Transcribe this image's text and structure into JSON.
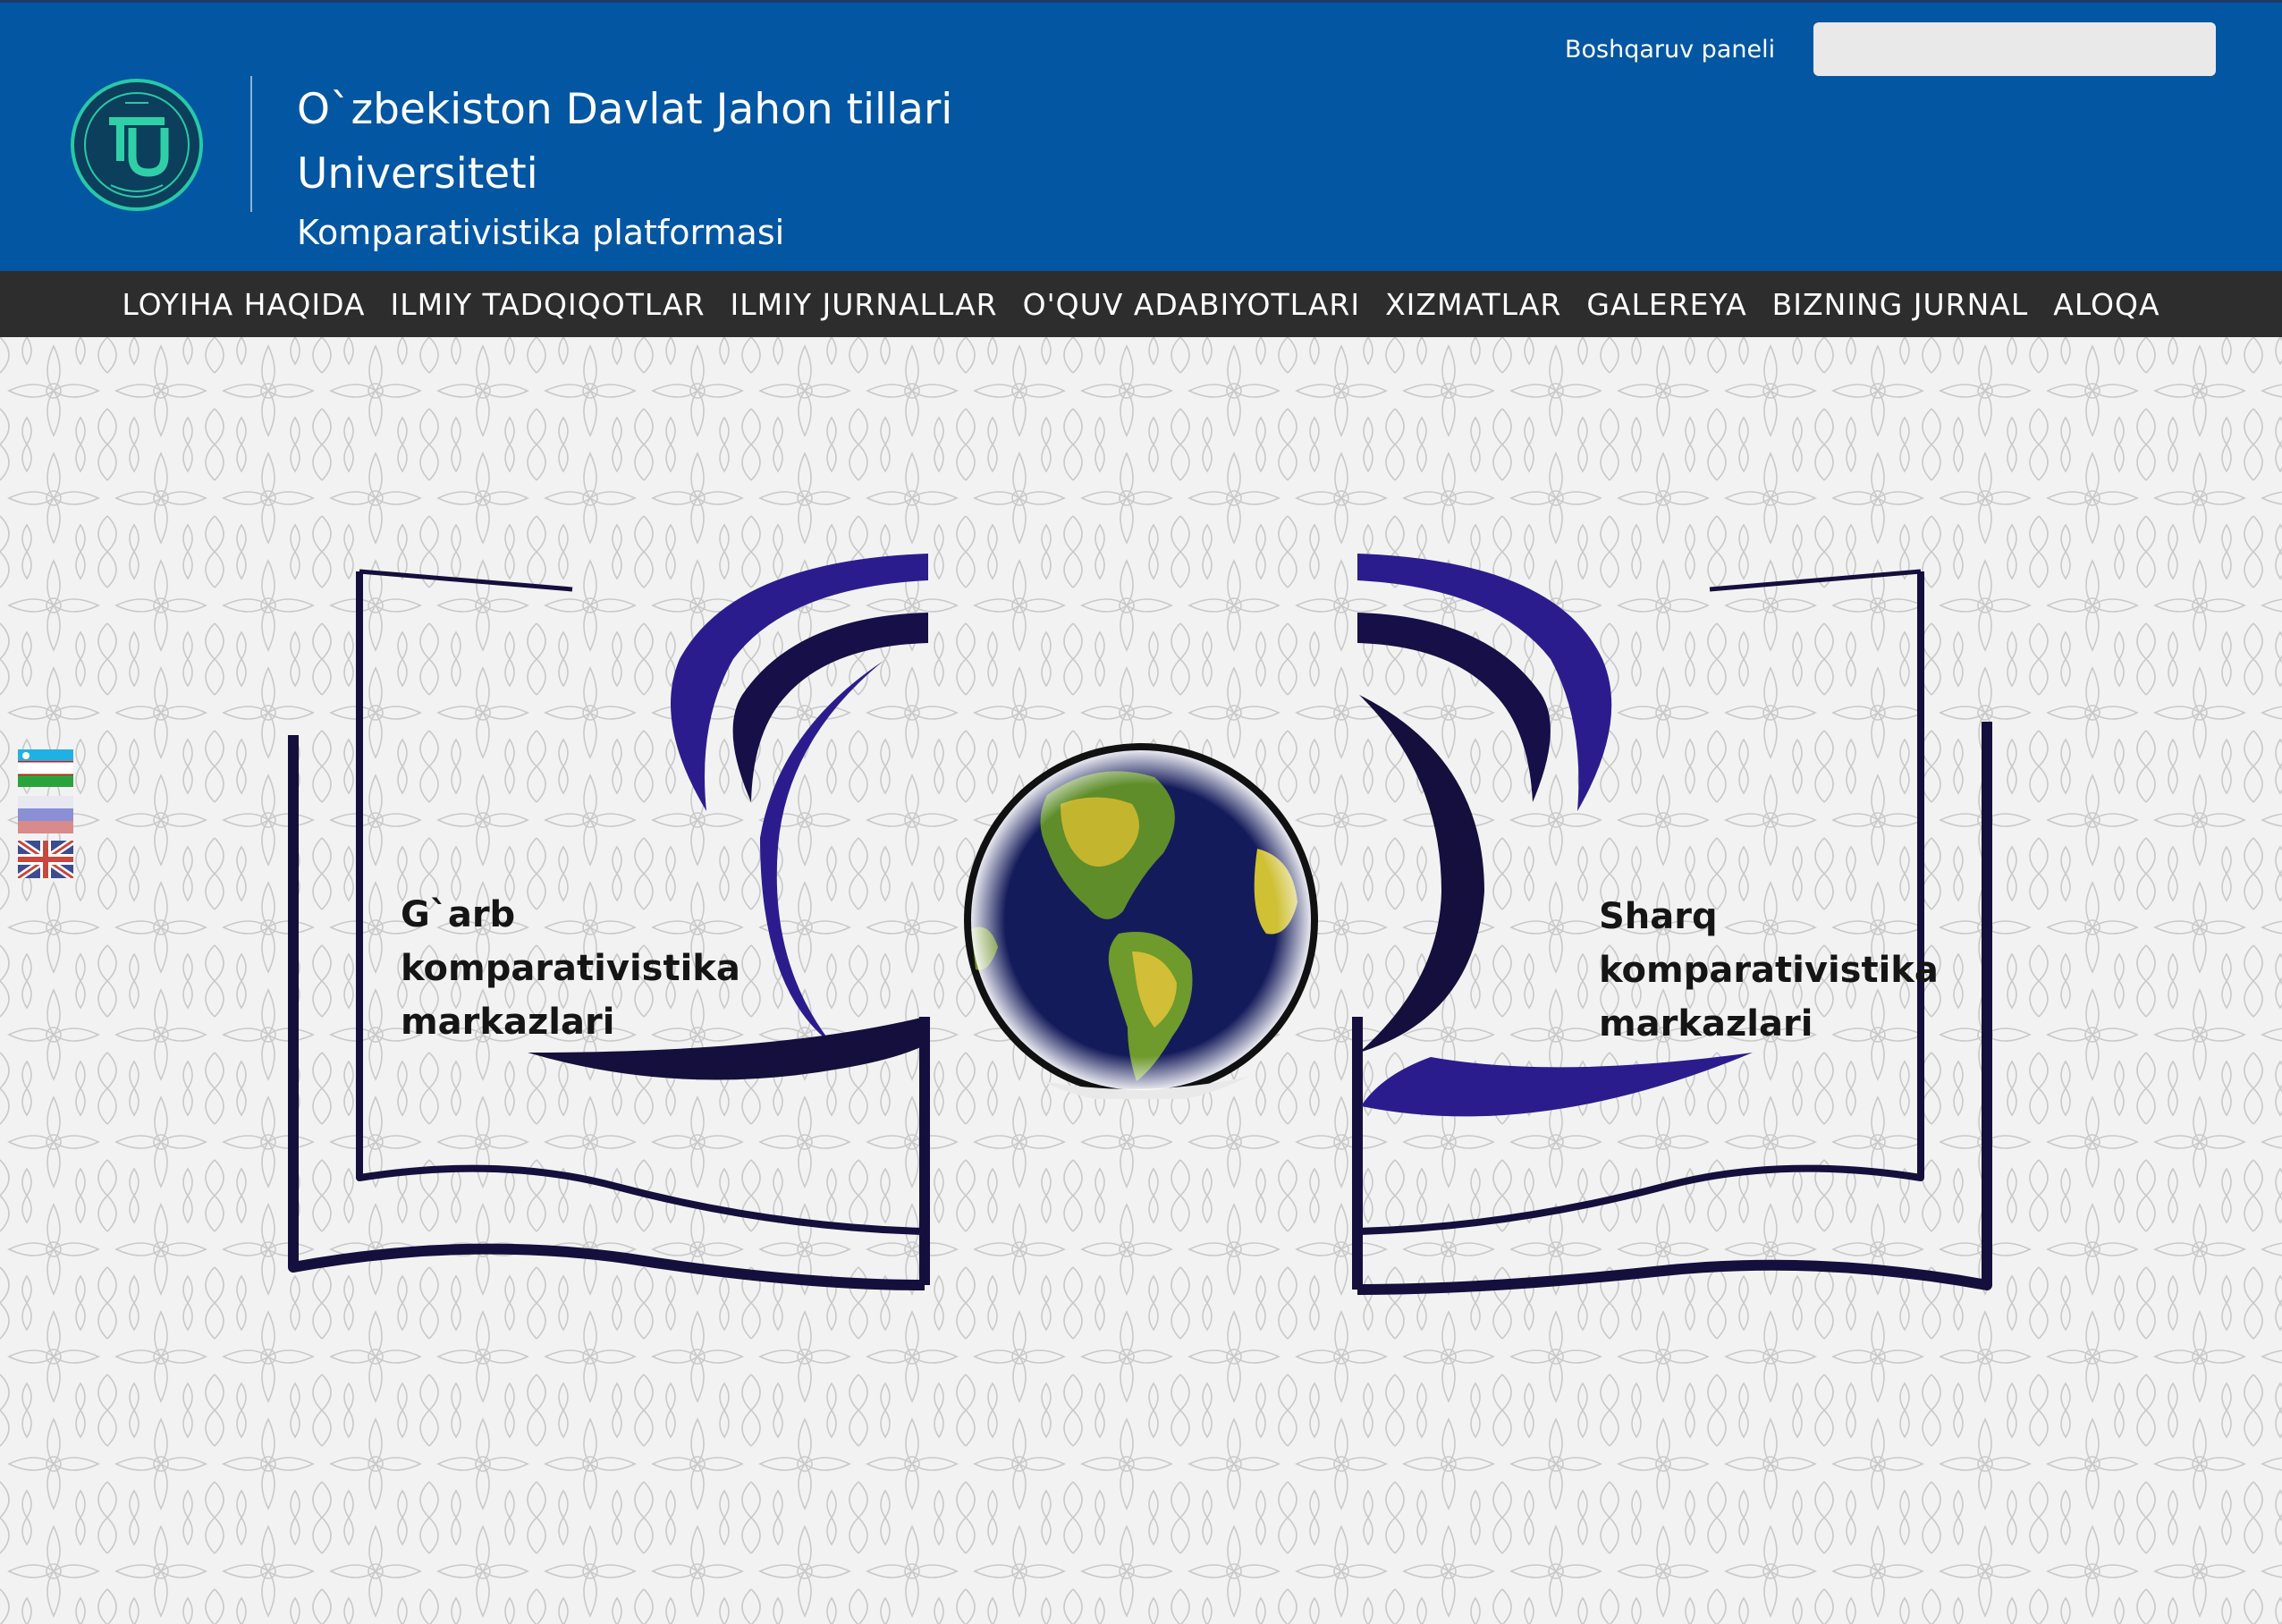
{
  "header": {
    "title_line1": "O`zbekiston Davlat Jahon tillari",
    "title_line2": "Universiteti",
    "subtitle": "Komparativistika platformasi",
    "admin_link": "Boshqaruv paneli",
    "search_value": "",
    "background_color": "#0356a2",
    "logo_icon": "university-logo-icon"
  },
  "nav": {
    "background_color": "#2d2d2d",
    "items": [
      {
        "label": "LOYIHA HAQIDA"
      },
      {
        "label": "ILMIY TADQIQOTLAR"
      },
      {
        "label": "ILMIY JURNALLAR"
      },
      {
        "label": "O'QUV ADABIYOTLARI"
      },
      {
        "label": "XIZMATLAR"
      },
      {
        "label": "GALEREYA"
      },
      {
        "label": "BIZNING JURNAL"
      },
      {
        "label": "ALOQA"
      }
    ]
  },
  "hero": {
    "left_book": {
      "line1": "G`arb",
      "line2": "komparativistika",
      "line3": "markazlari"
    },
    "right_book": {
      "line1": "Sharq",
      "line2": "komparativistika",
      "line3": "markazlari"
    },
    "accent_color": "#2b1c8e",
    "dark_color": "#140f3c",
    "globe_icon": "globe-icon",
    "book_icon": "open-book-icon"
  },
  "languages": [
    {
      "code": "uz",
      "icon": "uzbekistan-flag-icon"
    },
    {
      "code": "ru",
      "icon": "russia-flag-icon"
    },
    {
      "code": "en",
      "icon": "uk-flag-icon"
    }
  ]
}
